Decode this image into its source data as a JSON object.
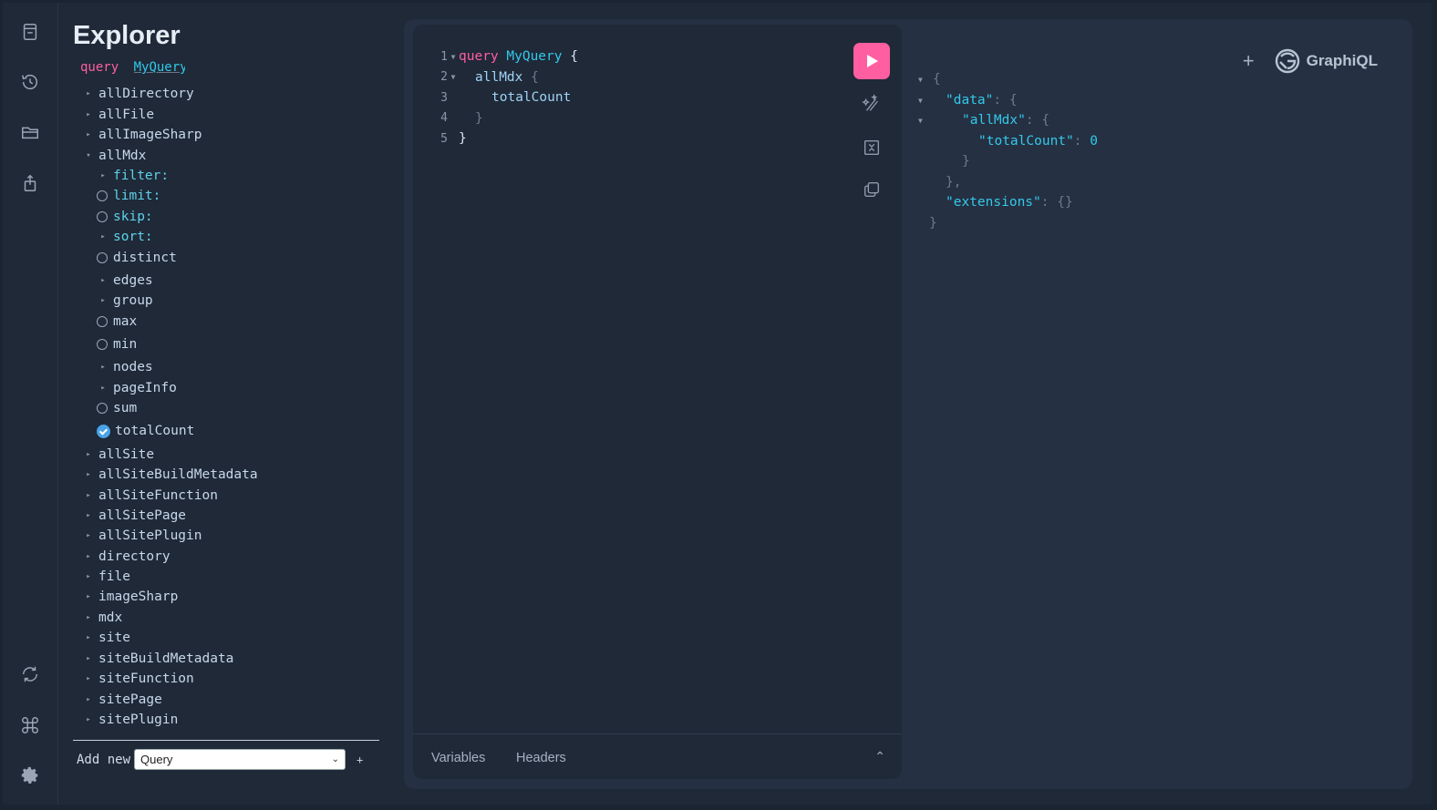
{
  "explorer": {
    "title": "Explorer",
    "operation_keyword": "query",
    "operation_name": "MyQuery",
    "tree": [
      {
        "label": "allDirectory",
        "level": 0,
        "kind": "caret"
      },
      {
        "label": "allFile",
        "level": 0,
        "kind": "caret"
      },
      {
        "label": "allImageSharp",
        "level": 0,
        "kind": "caret"
      },
      {
        "label": "allMdx",
        "level": 0,
        "kind": "caret-open"
      },
      {
        "label": "filter:",
        "level": 1,
        "kind": "caret",
        "arg": true
      },
      {
        "label": "limit:",
        "level": 1,
        "kind": "radio",
        "arg": true
      },
      {
        "label": "skip:",
        "level": 1,
        "kind": "radio",
        "arg": true
      },
      {
        "label": "sort:",
        "level": 1,
        "kind": "caret",
        "arg": true
      },
      {
        "label": "distinct",
        "level": 1,
        "kind": "radio"
      },
      {
        "label": "edges",
        "level": 1,
        "kind": "caret"
      },
      {
        "label": "group",
        "level": 1,
        "kind": "caret"
      },
      {
        "label": "max",
        "level": 1,
        "kind": "radio"
      },
      {
        "label": "min",
        "level": 1,
        "kind": "radio"
      },
      {
        "label": "nodes",
        "level": 1,
        "kind": "caret"
      },
      {
        "label": "pageInfo",
        "level": 1,
        "kind": "caret"
      },
      {
        "label": "sum",
        "level": 1,
        "kind": "radio"
      },
      {
        "label": "totalCount",
        "level": 1,
        "kind": "checked"
      },
      {
        "label": "allSite",
        "level": 0,
        "kind": "caret"
      },
      {
        "label": "allSiteBuildMetadata",
        "level": 0,
        "kind": "caret"
      },
      {
        "label": "allSiteFunction",
        "level": 0,
        "kind": "caret"
      },
      {
        "label": "allSitePage",
        "level": 0,
        "kind": "caret"
      },
      {
        "label": "allSitePlugin",
        "level": 0,
        "kind": "caret"
      },
      {
        "label": "directory",
        "level": 0,
        "kind": "caret"
      },
      {
        "label": "file",
        "level": 0,
        "kind": "caret"
      },
      {
        "label": "imageSharp",
        "level": 0,
        "kind": "caret"
      },
      {
        "label": "mdx",
        "level": 0,
        "kind": "caret"
      },
      {
        "label": "site",
        "level": 0,
        "kind": "caret"
      },
      {
        "label": "siteBuildMetadata",
        "level": 0,
        "kind": "caret"
      },
      {
        "label": "siteFunction",
        "level": 0,
        "kind": "caret"
      },
      {
        "label": "sitePage",
        "level": 0,
        "kind": "caret"
      },
      {
        "label": "sitePlugin",
        "level": 0,
        "kind": "caret"
      }
    ],
    "footer": {
      "add_new_label": "Add new",
      "select_value": "Query",
      "plus": "+"
    }
  },
  "editor": {
    "line_numbers": [
      "1",
      "2",
      "3",
      "4",
      "5"
    ],
    "line1_keyword": "query",
    "line1_name": "MyQuery",
    "line1_brace": "{",
    "line2_field": "allMdx",
    "line2_brace": "{",
    "line3_field": "totalCount",
    "line4_brace": "}",
    "line5_brace": "}"
  },
  "bottom_tabs": {
    "variables": "Variables",
    "headers": "Headers"
  },
  "result": {
    "open_brace": "{",
    "data_key": "\"data\"",
    "allmdx_key": "\"allMdx\"",
    "totalcount_key": "\"totalCount\"",
    "totalcount_value": "0",
    "extensions_key": "\"extensions\"",
    "extensions_value": "{}",
    "colon": ":",
    "brace_open": "{",
    "brace_close": "}",
    "brace_close_comma": "},"
  },
  "header": {
    "plus": "+",
    "brand": "GraphiQL"
  },
  "colors": {
    "accent_pink": "#ff5fa0",
    "accent_cyan": "#33c9ea",
    "background": "#1f2938"
  }
}
